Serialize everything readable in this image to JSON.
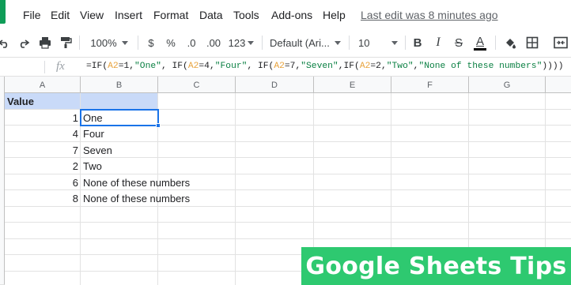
{
  "menubar": {
    "items": [
      "File",
      "Edit",
      "View",
      "Insert",
      "Format",
      "Data",
      "Tools",
      "Add-ons",
      "Help"
    ],
    "last_edit": "Last edit was 8 minutes ago"
  },
  "toolbar": {
    "zoom": "100%",
    "currency": "$",
    "percent": "%",
    "decrease_decimals": ".0",
    "increase_decimals": ".00",
    "more_formats": "123",
    "font": "Default (Ari...",
    "font_size": "10",
    "bold": "B",
    "italic": "I",
    "strikethrough": "S",
    "text_color": "A",
    "text_color_swatch": "#000000"
  },
  "formula_bar": {
    "fx": "fx",
    "segments": [
      {
        "t": "=IF(",
        "k": "plain"
      },
      {
        "t": "A2",
        "k": "ref"
      },
      {
        "t": "=1,",
        "k": "plain"
      },
      {
        "t": "\"One\"",
        "k": "str"
      },
      {
        "t": ", IF(",
        "k": "plain"
      },
      {
        "t": "A2",
        "k": "ref"
      },
      {
        "t": "=4,",
        "k": "plain"
      },
      {
        "t": "\"Four\"",
        "k": "str"
      },
      {
        "t": ", IF(",
        "k": "plain"
      },
      {
        "t": "A2",
        "k": "ref"
      },
      {
        "t": "=7,",
        "k": "plain"
      },
      {
        "t": "\"Seven\"",
        "k": "str"
      },
      {
        "t": ",IF(",
        "k": "plain"
      },
      {
        "t": "A2",
        "k": "ref"
      },
      {
        "t": "=2,",
        "k": "plain"
      },
      {
        "t": "\"Two\"",
        "k": "str"
      },
      {
        "t": ",",
        "k": "plain"
      },
      {
        "t": "\"None of these numbers\"",
        "k": "str"
      },
      {
        "t": "))))",
        "k": "plain"
      }
    ]
  },
  "grid": {
    "columns": [
      "A",
      "B",
      "C",
      "D",
      "E",
      "F",
      "G"
    ],
    "header": {
      "a": "Value",
      "b": ""
    },
    "rows": [
      {
        "a": "1",
        "b": "One"
      },
      {
        "a": "4",
        "b": "Four"
      },
      {
        "a": "7",
        "b": "Seven"
      },
      {
        "a": "2",
        "b": "Two"
      },
      {
        "a": "6",
        "b": "None of these numbers"
      },
      {
        "a": "8",
        "b": "None of these numbers"
      }
    ],
    "header_fill": "#c9daf8",
    "selection_color": "#1a73e8"
  },
  "banner": {
    "text": "Google Sheets Tips",
    "color": "#2ec970"
  }
}
